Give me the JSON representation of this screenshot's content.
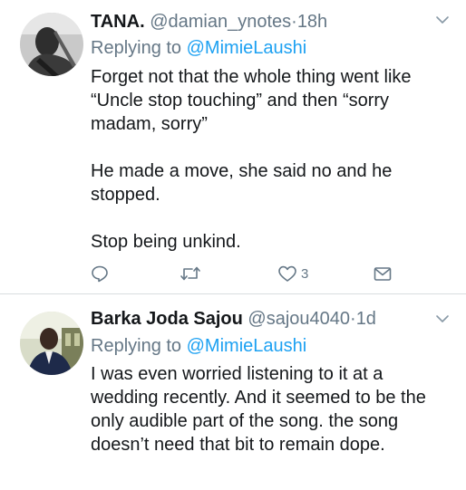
{
  "tweets": [
    {
      "display_name": "TANA.",
      "handle": "@damian_ynotes",
      "separator": "·",
      "time": "18h",
      "replying_prefix": "Replying to",
      "replying_to": "@MimieLaushi",
      "paragraphs": [
        "Forget not that the whole thing went  like “Uncle stop touching” and then “sorry madam, sorry”",
        "He made a move, she said no and he stopped.",
        "Stop being unkind."
      ],
      "like_count": "3",
      "icons": [
        "reply-icon",
        "retweet-icon",
        "like-icon",
        "direct-message-icon",
        "chevron-down-icon"
      ]
    },
    {
      "display_name": "Barka Joda Sajou",
      "handle": "@sajou4040",
      "separator": "·",
      "time": "1d",
      "replying_prefix": "Replying to",
      "replying_to": "@MimieLaushi",
      "paragraphs": [
        "I was even worried listening to it at a wedding recently. And it seemed to be the only audible part of the song. the song doesn’t need that bit to remain dope."
      ]
    }
  ],
  "colors": {
    "text": "#14171a",
    "secondary": "#657786",
    "link": "#1da1f2",
    "divider": "#d9dde0"
  }
}
